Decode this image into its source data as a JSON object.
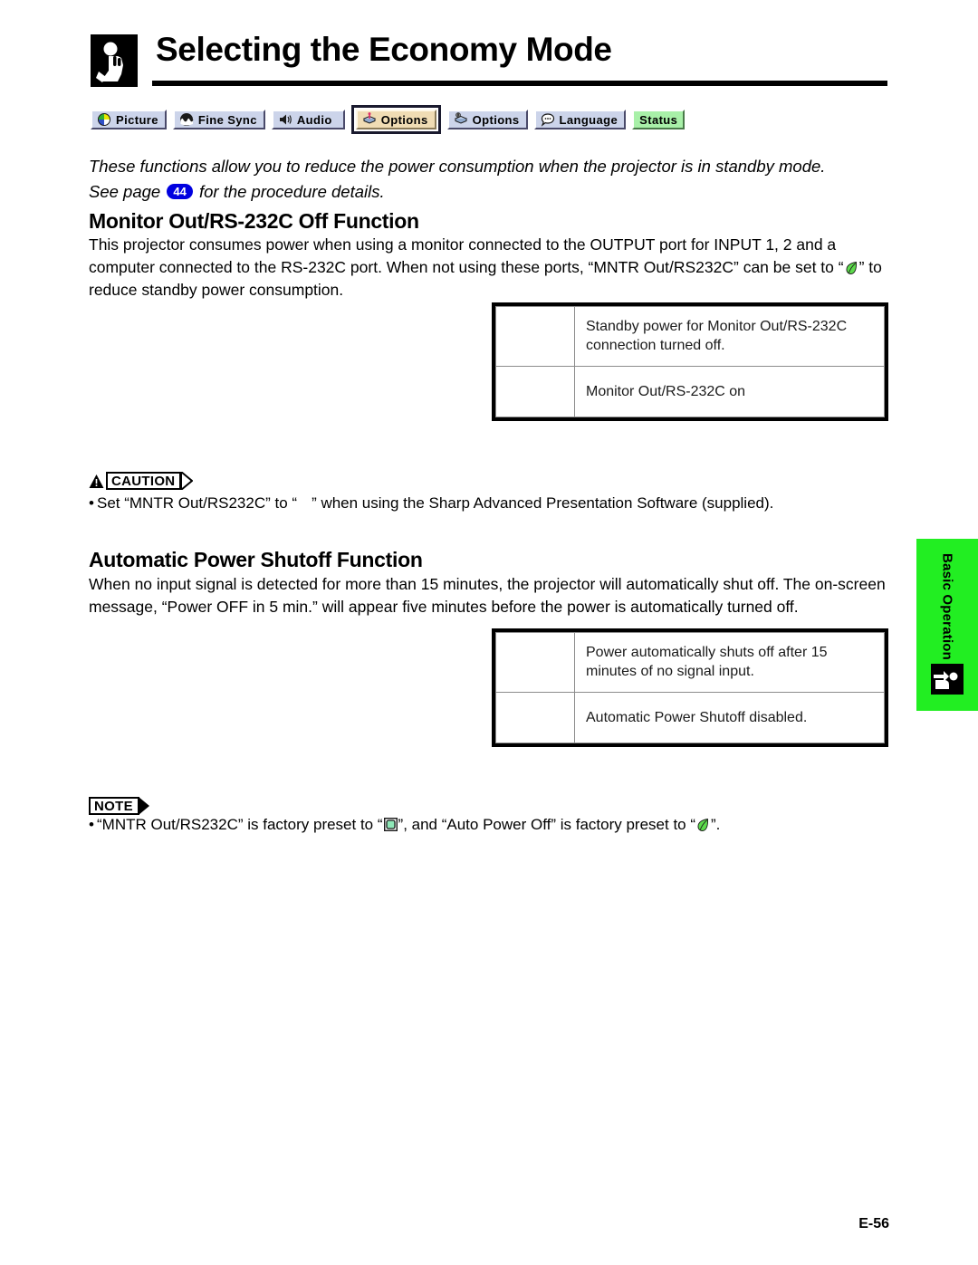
{
  "page": {
    "title": "Selecting the Economy Mode",
    "footer": "E-56",
    "header_icon": "hand-pressing-button-icon"
  },
  "tabbar": {
    "tabs": [
      {
        "label": "Picture",
        "icon": "color-wheel-icon",
        "state": "normal"
      },
      {
        "label": "Fine Sync",
        "icon": "waveform-icon",
        "state": "normal"
      },
      {
        "label": "Audio",
        "icon": "speaker-icon",
        "state": "normal"
      },
      {
        "label": "Options",
        "icon": "options-pin-icon",
        "state": "selected"
      },
      {
        "label": "Options",
        "icon": "options-globe-icon",
        "state": "normal"
      },
      {
        "label": "Language",
        "icon": "speech-bubble-icon",
        "state": "normal"
      },
      {
        "label": "Status",
        "icon": "none",
        "state": "status"
      }
    ]
  },
  "intro": {
    "line1": "These functions allow you to reduce the power consumption when the projector is in standby mode.",
    "line2_before": "See page",
    "page_ref": "44",
    "line2_after": "for the procedure details."
  },
  "sections": [
    {
      "heading": "Monitor Out/RS-232C Off Function",
      "body_part1": "This projector consumes power when using a monitor connected to the OUTPUT port for INPUT 1, 2 and a computer connected to the RS-232C port. When not using these ports, “MNTR Out/RS232C” can be set to “",
      "body_icon": "green-leaf-icon",
      "body_part2": "” to reduce standby power consumption.",
      "table": {
        "rows": [
          {
            "icon": "",
            "text": "Standby power for Monitor Out/RS-232C connection turned off."
          },
          {
            "icon": "",
            "text": "Monitor Out/RS-232C on"
          }
        ]
      }
    },
    {
      "heading": "Automatic Power Shutoff Function",
      "body_part1": "When no input signal is detected for more than 15 minutes, the projector will automatically shut off. The on-screen message, “Power OFF in 5 min.” will appear five minutes before the power is automatically turned off.",
      "body_icon": "",
      "body_part2": "",
      "table": {
        "rows": [
          {
            "icon": "",
            "text": "Power automatically shuts off after 15 minutes of no signal input."
          },
          {
            "icon": "",
            "text": "Automatic Power Shutoff disabled."
          }
        ]
      }
    }
  ],
  "caution": {
    "label": "CAUTION",
    "icon": "warning-triangle-icon",
    "text_part1": "Set “MNTR Out/RS232C” to “",
    "inline_icon": "blank-icon",
    "text_part2": "” when using the Sharp Advanced Presentation Software (supplied)."
  },
  "note": {
    "label": "NOTE",
    "text_part1": "“MNTR Out/RS232C” is factory preset to “",
    "inline_icon1": "green-monitor-icon",
    "text_part2": "”, and “Auto Power Off” is factory preset to “",
    "inline_icon2": "green-leaf-icon",
    "text_part3": "”."
  },
  "sidetab": {
    "label": "Basic Operation",
    "icon": "hand-pointing-icon",
    "color": "#22ee22"
  },
  "colors": {
    "tab_normal_bg": "#ccd4ea",
    "tab_selected_bg": "#f0dcb4",
    "tab_status_bg": "#a8f0a8",
    "page_badge_bg": "#0000e0",
    "leaf_green": "#5ddb4c",
    "sidetab_green": "#22ee22"
  }
}
